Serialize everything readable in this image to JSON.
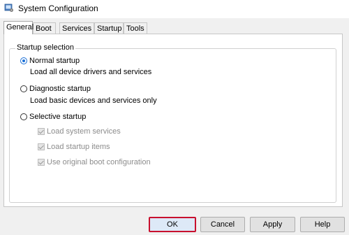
{
  "window": {
    "title": "System Configuration",
    "icon": "msconfig-icon"
  },
  "tabs": [
    {
      "label": "General",
      "active": true
    },
    {
      "label": "Boot",
      "active": false
    },
    {
      "label": "Services",
      "active": false
    },
    {
      "label": "Startup",
      "active": false
    },
    {
      "label": "Tools",
      "active": false
    }
  ],
  "startup_selection": {
    "legend": "Startup selection",
    "normal": {
      "label": "Normal startup",
      "description": "Load all device drivers and services",
      "checked": true
    },
    "diagnostic": {
      "label": "Diagnostic startup",
      "description": "Load basic devices and services only",
      "checked": false
    },
    "selective": {
      "label": "Selective startup",
      "checked": false,
      "options": [
        {
          "label": "Load system services",
          "checked": true,
          "enabled": false
        },
        {
          "label": "Load startup items",
          "checked": true,
          "enabled": false
        },
        {
          "label": "Use original boot configuration",
          "checked": true,
          "enabled": false
        }
      ]
    }
  },
  "buttons": {
    "ok": "OK",
    "cancel": "Cancel",
    "apply": "Apply",
    "help": "Help"
  },
  "colors": {
    "accent": "#1a6fd6",
    "highlight_border": "#c8102e"
  }
}
